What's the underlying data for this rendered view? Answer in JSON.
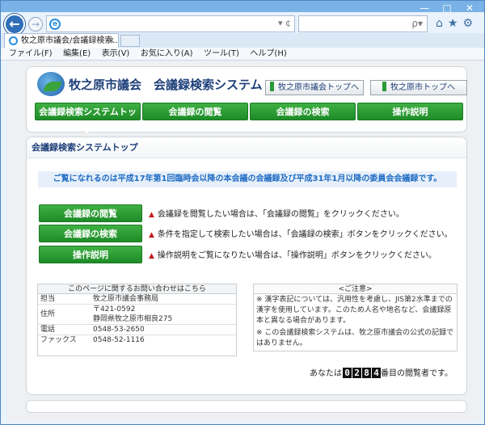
{
  "browser": {
    "window_controls": [
      "—",
      "□",
      "✕"
    ],
    "address_placeholder": "",
    "search_placeholder": "",
    "tab_title": "牧之原市議会/会議録検索...",
    "tab_close": "×",
    "address_controls": "▾ ¢",
    "search_glyph": "ρ▾",
    "tb_icons": "⌂★⚙",
    "back_glyph": "←",
    "fwd_glyph": "→"
  },
  "menu": [
    "ファイル(F)",
    "編集(E)",
    "表示(V)",
    "お気に入り(A)",
    "ツール(T)",
    "ヘルプ(H)"
  ],
  "header": {
    "title": "牧之原市議会　会議録検索システム",
    "links": [
      "牧之原市議会トップへ",
      "牧之原市トップへ"
    ]
  },
  "gnav": [
    "会議録検索システムトップ",
    "会議録の閲覧",
    "会議録の検索",
    "操作説明"
  ],
  "main": {
    "heading": "会議録検索システムトップ",
    "notice": "ご覧になれるのは平成17年第1回臨時会以降の本会議の会議録及び平成31年1月以降の委員会会議録です。",
    "buttons": [
      {
        "label": "会議録の閲覧",
        "desc": "会議録を閲覧したい場合は、「会議録の閲覧」をクリックください。"
      },
      {
        "label": "会議録の検索",
        "desc": "条件を指定して検索したい場合は、「会議録の検索」ボタンをクリックください。"
      },
      {
        "label": "操作説明",
        "desc": "操作説明をご覧になりたい場合は、「操作説明」ボタンをクリックください。"
      }
    ],
    "arrow": "▲"
  },
  "contact": {
    "title": "このページに関するお問い合わせはこちら",
    "rows": [
      {
        "k": "担当",
        "v": "牧之原市議会事務局"
      },
      {
        "k": "住所",
        "v": "〒421-0592",
        "v2": "静岡県牧之原市相良275"
      },
      {
        "k": "電話",
        "v": "0548-53-2650"
      },
      {
        "k": "ファックス",
        "v": "0548-52-1116"
      }
    ]
  },
  "caution": {
    "title": "<ご注意>",
    "p1": "※ 漢字表記については、汎用性を考慮し、JIS第2水準までの漢字を使用しています。このため人名や地名など、会議録原本と異なる場合があります。",
    "p2": "※ この会議録検索システムは、牧之原市議会の公式の記録ではありません。"
  },
  "counter": {
    "prefix": "あなたは",
    "digits": [
      "0",
      "2",
      "8",
      "4"
    ],
    "suffix": "番目の閲覧者です。"
  }
}
